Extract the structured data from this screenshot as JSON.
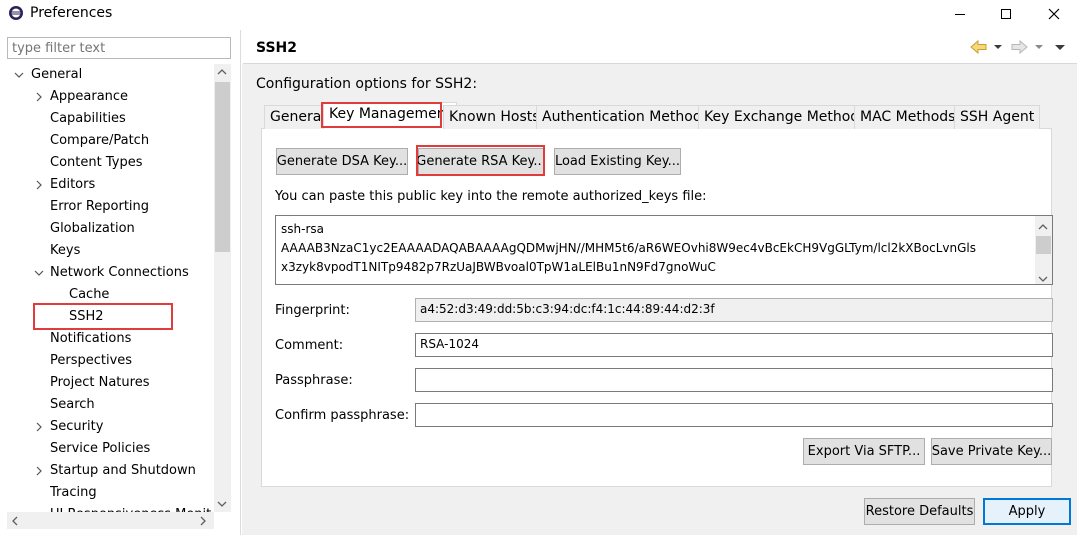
{
  "window": {
    "title": "Preferences"
  },
  "filter": {
    "placeholder": "type filter text"
  },
  "tree": {
    "items": [
      {
        "label": "General",
        "level": 0,
        "chevron": "down"
      },
      {
        "label": "Appearance",
        "level": 1,
        "chevron": "right"
      },
      {
        "label": "Capabilities",
        "level": 1,
        "chevron": ""
      },
      {
        "label": "Compare/Patch",
        "level": 1,
        "chevron": ""
      },
      {
        "label": "Content Types",
        "level": 1,
        "chevron": ""
      },
      {
        "label": "Editors",
        "level": 1,
        "chevron": "right"
      },
      {
        "label": "Error Reporting",
        "level": 1,
        "chevron": ""
      },
      {
        "label": "Globalization",
        "level": 1,
        "chevron": ""
      },
      {
        "label": "Keys",
        "level": 1,
        "chevron": ""
      },
      {
        "label": "Network Connections",
        "level": 1,
        "chevron": "down"
      },
      {
        "label": "Cache",
        "level": 2,
        "chevron": ""
      },
      {
        "label": "SSH2",
        "level": 2,
        "chevron": "",
        "selected": true
      },
      {
        "label": "Notifications",
        "level": 1,
        "chevron": ""
      },
      {
        "label": "Perspectives",
        "level": 1,
        "chevron": ""
      },
      {
        "label": "Project Natures",
        "level": 1,
        "chevron": ""
      },
      {
        "label": "Search",
        "level": 1,
        "chevron": ""
      },
      {
        "label": "Security",
        "level": 1,
        "chevron": "right"
      },
      {
        "label": "Service Policies",
        "level": 1,
        "chevron": ""
      },
      {
        "label": "Startup and Shutdown",
        "level": 1,
        "chevron": "right"
      },
      {
        "label": "Tracing",
        "level": 1,
        "chevron": ""
      },
      {
        "label": "UI Responsiveness Monit",
        "level": 1,
        "chevron": ""
      }
    ]
  },
  "page": {
    "title": "SSH2",
    "config_label": "Configuration options for SSH2:"
  },
  "tabs": [
    {
      "label": "General",
      "active": false
    },
    {
      "label": "Key Management",
      "active": true
    },
    {
      "label": "Known Hosts",
      "active": false
    },
    {
      "label": "Authentication Methods",
      "active": false
    },
    {
      "label": "Key Exchange Methods",
      "active": false
    },
    {
      "label": "MAC Methods",
      "active": false
    },
    {
      "label": "SSH Agent",
      "active": false
    }
  ],
  "key_management": {
    "generate_dsa": "Generate DSA Key...",
    "generate_rsa": "Generate RSA Key...",
    "load_existing": "Load Existing Key...",
    "paste_label": "You can paste this public key into the remote authorized_keys file:",
    "public_key_lines": [
      "ssh-rsa",
      "AAAAB3NzaC1yc2EAAAADAQABAAAAgQDMwjHN//MHM5t6/aR6WEOvhi8W9ec4vBcEkCH9VgGLTym/lcl2kXBocLvnGls",
      "x3zyk8vpodT1NITp9482p7RzUaJBWBvoal0TpW1aLElBu1nN9Fd7gnoWuC"
    ],
    "fingerprint_label": "Fingerprint:",
    "fingerprint_value": "a4:52:d3:49:dd:5b:c3:94:dc:f4:1c:44:89:44:d2:3f",
    "comment_label": "Comment:",
    "comment_value": "RSA-1024",
    "passphrase_label": "Passphrase:",
    "passphrase_value": "",
    "confirm_label": "Confirm passphrase:",
    "confirm_value": "",
    "export_sftp": "Export Via SFTP...",
    "save_private": "Save Private Key..."
  },
  "footer": {
    "restore_defaults": "Restore Defaults",
    "apply": "Apply"
  },
  "colors": {
    "highlight_box": "#e03c3c",
    "default_button_border": "#0078d7"
  }
}
